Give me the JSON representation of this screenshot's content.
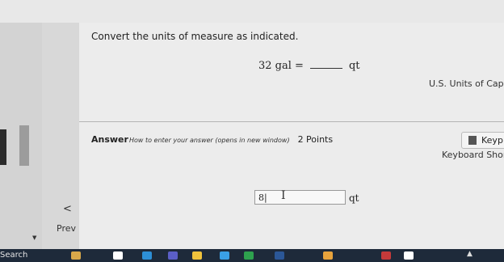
{
  "question": {
    "prompt": "Convert the units of measure as indicated.",
    "equation_left": "32 gal =",
    "equation_unit": "qt"
  },
  "resource_link": "U.S. Units of Capac",
  "answer": {
    "label": "Answer",
    "how_link": "How to enter your answer (opens in new window)",
    "points": "2 Points",
    "input_value": "8|",
    "unit": "qt"
  },
  "tools": {
    "keypad_label": "Keyp",
    "shortcuts_label": "Keyboard Short"
  },
  "nav": {
    "prev_chevron": "<",
    "prev_label": "Prev"
  },
  "taskbar": {
    "search_label": "Search",
    "icons": [
      "widgets-icon",
      "task-view-icon",
      "edge-icon",
      "teams-icon",
      "file-explorer-icon",
      "store-icon",
      "mail-icon",
      "word-icon",
      "chrome-icon",
      "calendar-icon",
      "app-icon"
    ]
  }
}
